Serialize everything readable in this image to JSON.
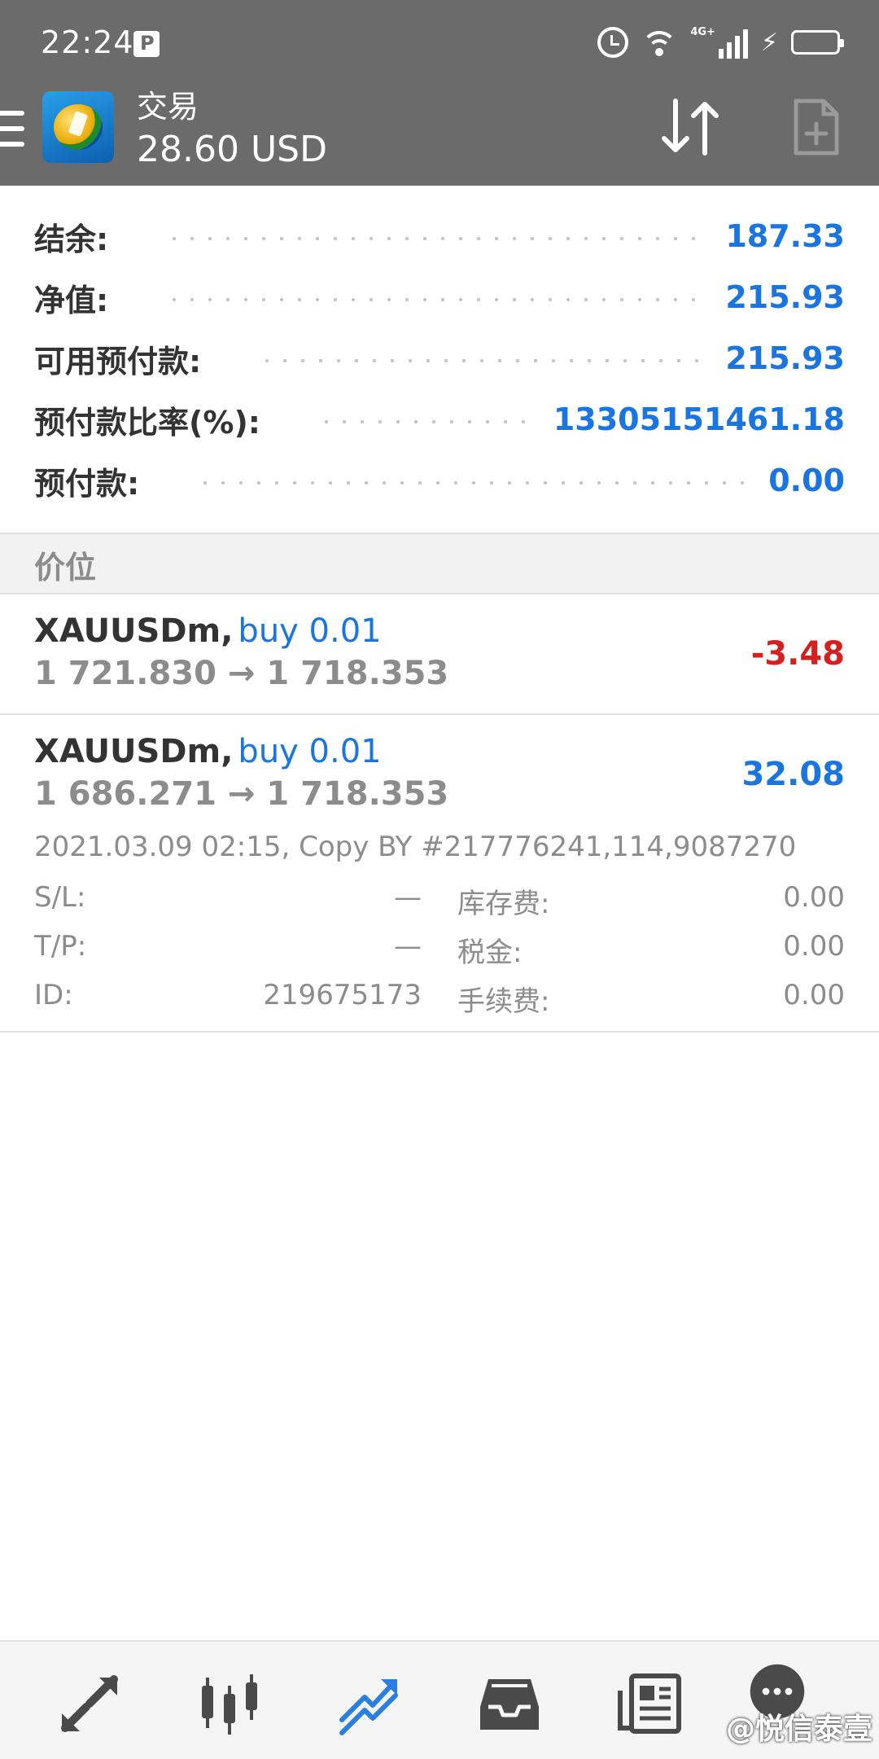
{
  "status_bar": {
    "time": "22:24",
    "network": "4G+",
    "battery_color": "#2ecc2e"
  },
  "app_bar": {
    "title": "交易",
    "balance_summary": "28.60 USD",
    "icons": [
      "menu-icon",
      "metatrader-logo",
      "sort-icon",
      "new-order-icon"
    ]
  },
  "account": {
    "rows": [
      {
        "label": "结余:",
        "value": "187.33"
      },
      {
        "label": "净值:",
        "value": "215.93"
      },
      {
        "label": "可用预付款:",
        "value": "215.93"
      },
      {
        "label": "预付款比率(%):",
        "value": "13305151461.18"
      },
      {
        "label": "预付款:",
        "value": "0.00"
      }
    ]
  },
  "positions_header": "价位",
  "positions": [
    {
      "symbol": "XAUUSDm,",
      "direction": "buy 0.01",
      "prices": "1 721.830 → 1 718.353",
      "profit": "-3.48"
    },
    {
      "symbol": "XAUUSDm,",
      "direction": "buy 0.01",
      "prices": "1 686.271 → 1 718.353",
      "profit": "32.08",
      "comment": "2021.03.09 02:15, Copy BY #217776241,114,9087270",
      "details": {
        "sl_label": "S/L:",
        "sl_value": "—",
        "tp_label": "T/P:",
        "tp_value": "—",
        "id_label": "ID:",
        "id_value": "219675173",
        "swap_label": "库存费:",
        "swap_value": "0.00",
        "tax_label": "税金:",
        "tax_value": "0.00",
        "fee_label": "手续费:",
        "fee_value": "0.00"
      }
    }
  ],
  "bottom_nav": {
    "items": [
      "quotes-icon",
      "chart-icon",
      "trade-icon",
      "history-icon",
      "news-icon",
      "messages-icon"
    ],
    "active": "trade-icon",
    "active_color": "#2a7de1"
  },
  "watermark": "@悦信泰壹",
  "colors": {
    "app_bar_bg": "#6b6b6b",
    "value_blue": "#1a75e0",
    "loss_red": "#d62020"
  }
}
